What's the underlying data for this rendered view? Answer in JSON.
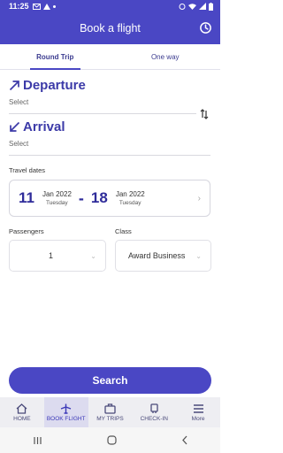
{
  "status": {
    "time": "11:25"
  },
  "header": {
    "title": "Book a flight"
  },
  "tabs": [
    {
      "label": "Round Trip"
    },
    {
      "label": "One way"
    }
  ],
  "departure": {
    "label": "Departure",
    "select": "Select"
  },
  "arrival": {
    "label": "Arrival",
    "select": "Select"
  },
  "travel_dates": {
    "label": "Travel dates",
    "start": {
      "day": "11",
      "month": "Jan 2022",
      "weekday": "Tuesday"
    },
    "dash": "-",
    "end": {
      "day": "18",
      "month": "Jan 2022",
      "weekday": "Tuesday"
    }
  },
  "passengers": {
    "label": "Passengers",
    "value": "1"
  },
  "class": {
    "label": "Class",
    "value": "Award Business"
  },
  "search_label": "Search",
  "nav": [
    {
      "label": "HOME",
      "icon": "home-icon"
    },
    {
      "label": "BOOK FLIGHT",
      "icon": "plane-icon"
    },
    {
      "label": "MY TRIPS",
      "icon": "trips-icon"
    },
    {
      "label": "CHECK-IN",
      "icon": "checkin-icon"
    },
    {
      "label": "More",
      "icon": "menu-icon"
    }
  ],
  "colors": {
    "primary": "#4a47c4",
    "accent_text": "#3c3aa8"
  }
}
